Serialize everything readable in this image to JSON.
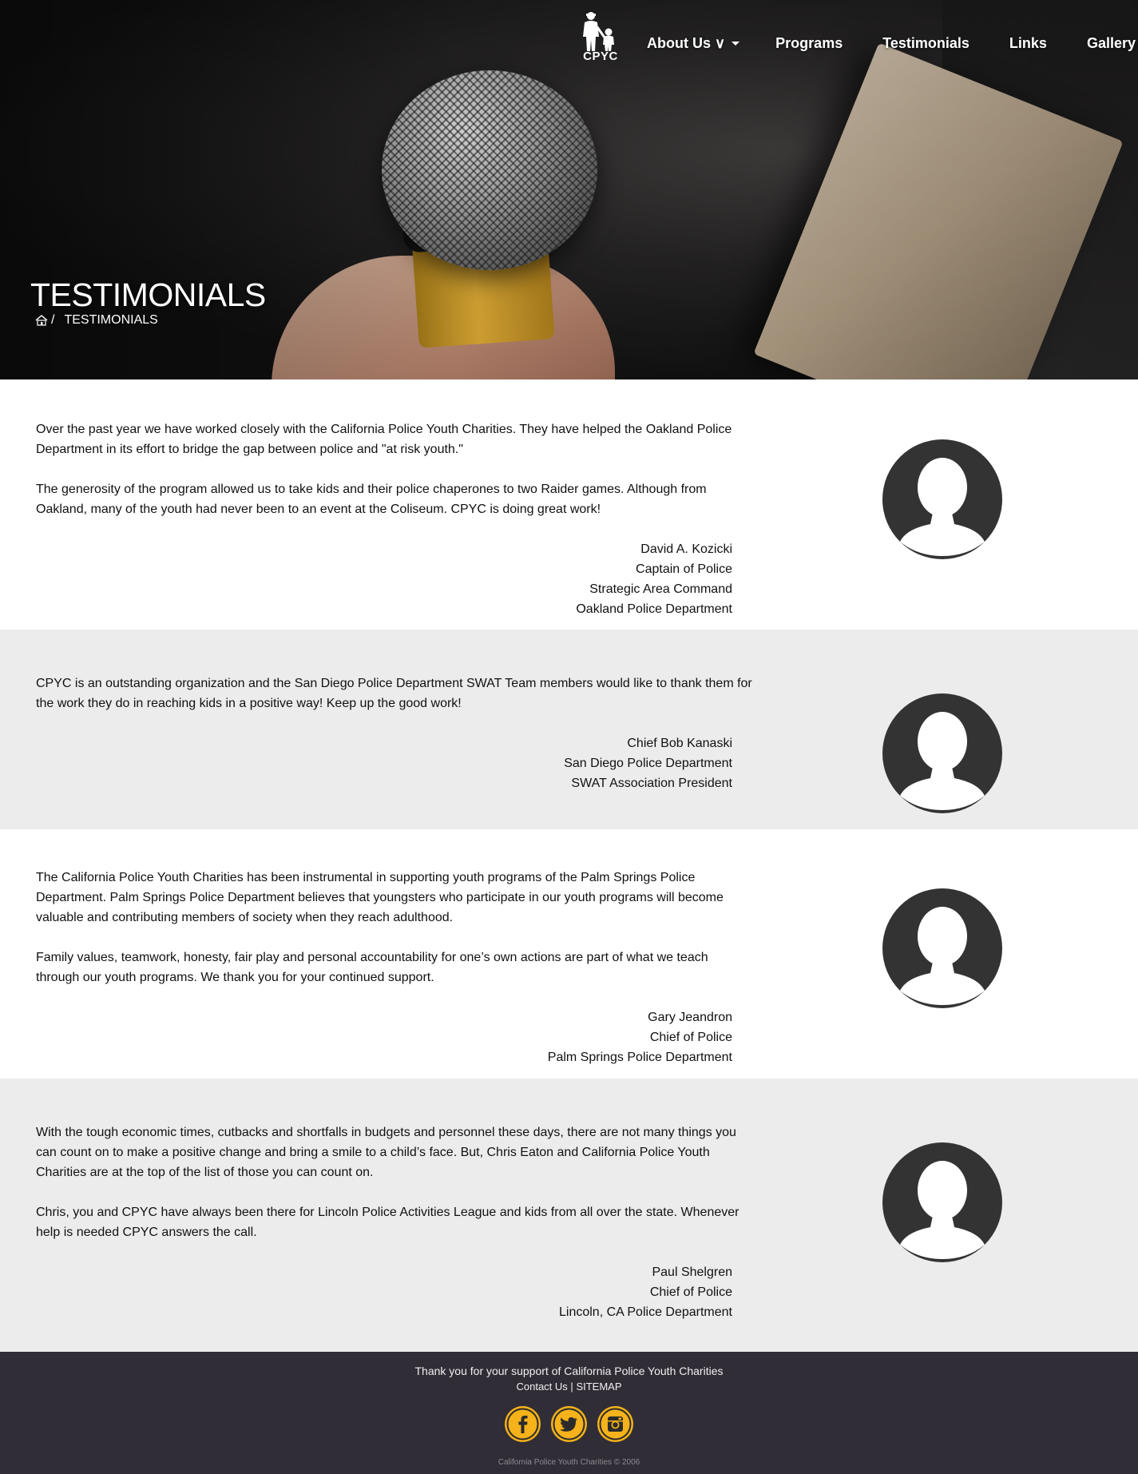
{
  "site": {
    "logo_text": "CPYC",
    "nav": [
      {
        "label": "About Us ∨"
      },
      {
        "label": "Programs"
      },
      {
        "label": "Testimonials"
      },
      {
        "label": "Links"
      },
      {
        "label": "Gallery"
      }
    ]
  },
  "hero": {
    "title": "TESTIMONIALS",
    "breadcrumb_separator": "/",
    "breadcrumb_current": "TESTIMONIALS"
  },
  "testimonials": [
    {
      "paragraphs": [
        "Over the past year we have worked closely with the California Police Youth Charities. They have helped the Oakland Police Department in its effort to bridge the gap between police and \"at risk youth.\"",
        "The generosity of the program allowed us to take kids and their police chaperones to two Raider games. Although from Oakland, many of the youth had never been to an event at the Coliseum. CPYC is doing great work!"
      ],
      "signature": [
        "David A. Kozicki",
        "Captain of Police",
        "Strategic Area Command",
        "Oakland Police Department"
      ]
    },
    {
      "paragraphs": [
        "CPYC is an outstanding organization and the San Diego Police Department SWAT Team members would like to thank them for the work they do in reaching kids in a positive way! Keep up the good work!"
      ],
      "signature": [
        "Chief Bob Kanaski",
        "San Diego Police Department",
        "SWAT Association President"
      ]
    },
    {
      "paragraphs": [
        "The California Police Youth Charities has been instrumental in supporting youth programs of the Palm Springs Police Department. Palm Springs Police Department believes that youngsters who participate in our youth programs will become valuable and contributing members of society when they reach adulthood.",
        "Family values, teamwork, honesty, fair play and personal accountability for one’s own actions are part of what we teach through our youth programs. We thank you for your continued support."
      ],
      "signature": [
        "Gary Jeandron",
        "Chief of Police",
        "Palm Springs Police Department"
      ]
    },
    {
      "paragraphs": [
        "With the tough economic times, cutbacks and shortfalls in budgets and personnel these days, there are not many things you can count on to make a positive change and bring a smile to a child’s face. But, Chris Eaton and California Police Youth Charities are at the top of the list of those you can count on.",
        "Chris, you and CPYC have always been there for Lincoln Police Activities League and kids from all over the state. Whenever help is needed CPYC answers the call."
      ],
      "signature": [
        "Paul Shelgren",
        "Chief of Police",
        "Lincoln, CA Police Department"
      ]
    }
  ],
  "footer": {
    "thanks": "Thank you for your support of California Police Youth Charities",
    "contact_label": "Contact Us",
    "divider": "|",
    "sitemap_label": "SITEMAP",
    "social": [
      "facebook-icon",
      "twitter-icon",
      "instagram-icon"
    ],
    "copyright": "California Police Youth Charities © 2006"
  },
  "colors": {
    "footer_bg": "#312d37",
    "social_accent": "#f5b21a",
    "avatar": "#333333",
    "gray_band": "#ececec"
  }
}
